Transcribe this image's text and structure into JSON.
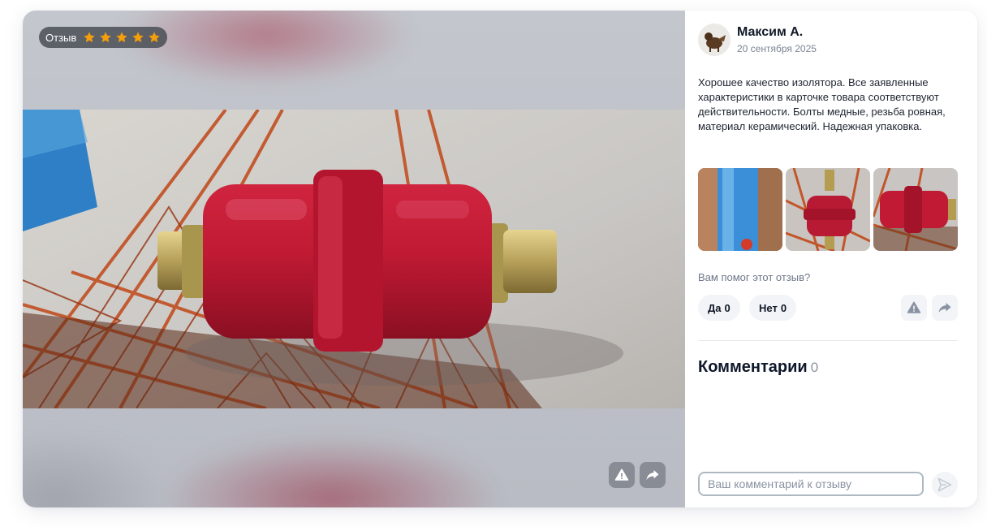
{
  "media": {
    "badge_label": "Отзыв",
    "rating": 5,
    "rating_max": 5,
    "star_color": "#f59e0b",
    "buttons": [
      {
        "icon": "warning-icon"
      },
      {
        "icon": "share-icon"
      }
    ]
  },
  "review": {
    "author": "Максим А.",
    "date": "20 сентября 2025",
    "text": "Хорошее качество изолятора. Все заявленные характеристики в карточке товара соответствуют действительности. Болты медные, резьба ровная, материал керамический. Надежная упаковка.",
    "photos_count": 3
  },
  "helpful": {
    "question": "Вам помог этот отзыв?",
    "yes_label": "Да",
    "yes_count": "0",
    "no_label": "Нет",
    "no_count": "0"
  },
  "comments": {
    "title": "Комментарии",
    "count": "0",
    "input_placeholder": "Ваш комментарий к отзыву"
  },
  "colors": {
    "accent_text": "#111827",
    "muted_text": "#6f7889",
    "button_bg": "#f2f4f7"
  }
}
